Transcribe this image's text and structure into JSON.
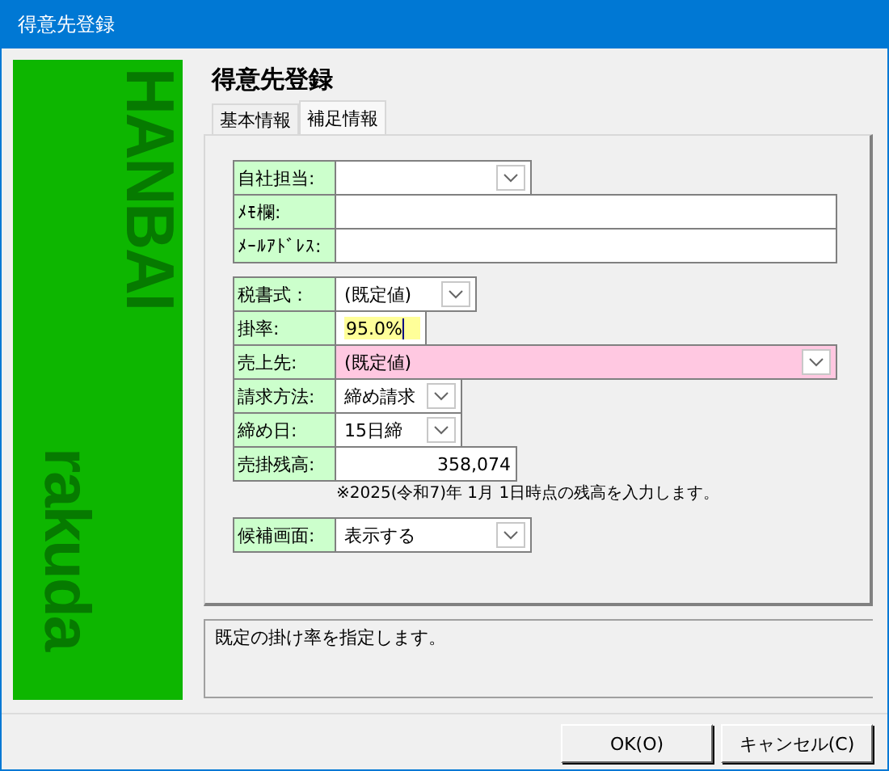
{
  "window": {
    "title": "得意先登録"
  },
  "logo": {
    "lines": [
      "HANBAI",
      "rakuda"
    ]
  },
  "heading": "得意先登録",
  "tabs": [
    {
      "label": "基本情報",
      "selected": false
    },
    {
      "label": "補足情報",
      "selected": true
    }
  ],
  "groups": [
    [
      {
        "label": "自社担当:",
        "kind": "combo"
      },
      {
        "label": "ﾒﾓ欄:",
        "kind": "text"
      },
      {
        "label": "ﾒｰﾙｱﾄﾞﾚｽ:",
        "kind": "text"
      }
    ],
    [
      {
        "label": "税書式：",
        "kind": "combo",
        "value": "(既定値)"
      },
      {
        "label": "掛率:",
        "kind": "text",
        "value": "95.0%",
        "color": "#ffff99",
        "focused": true
      },
      {
        "label": "売上先:",
        "kind": "combo",
        "value": "(既定値)",
        "color": "#ffc8e1"
      },
      {
        "label": "請求方法:",
        "kind": "combo",
        "value": "締め請求"
      },
      {
        "label": "締め日:",
        "kind": "combo",
        "value": "15日締"
      },
      {
        "label": "売掛残高:",
        "kind": "number",
        "value": "358,074"
      },
      {
        "kind": "note",
        "text": "※2025(令和7)年 1月 1日時点の残高を入力します。"
      }
    ],
    [
      {
        "label": "候補画面:",
        "kind": "combo",
        "value": "表示する"
      }
    ]
  ],
  "help": "既定の掛け率を指定します。",
  "buttons": [
    "OK(O)",
    "キャンセル(C)"
  ]
}
